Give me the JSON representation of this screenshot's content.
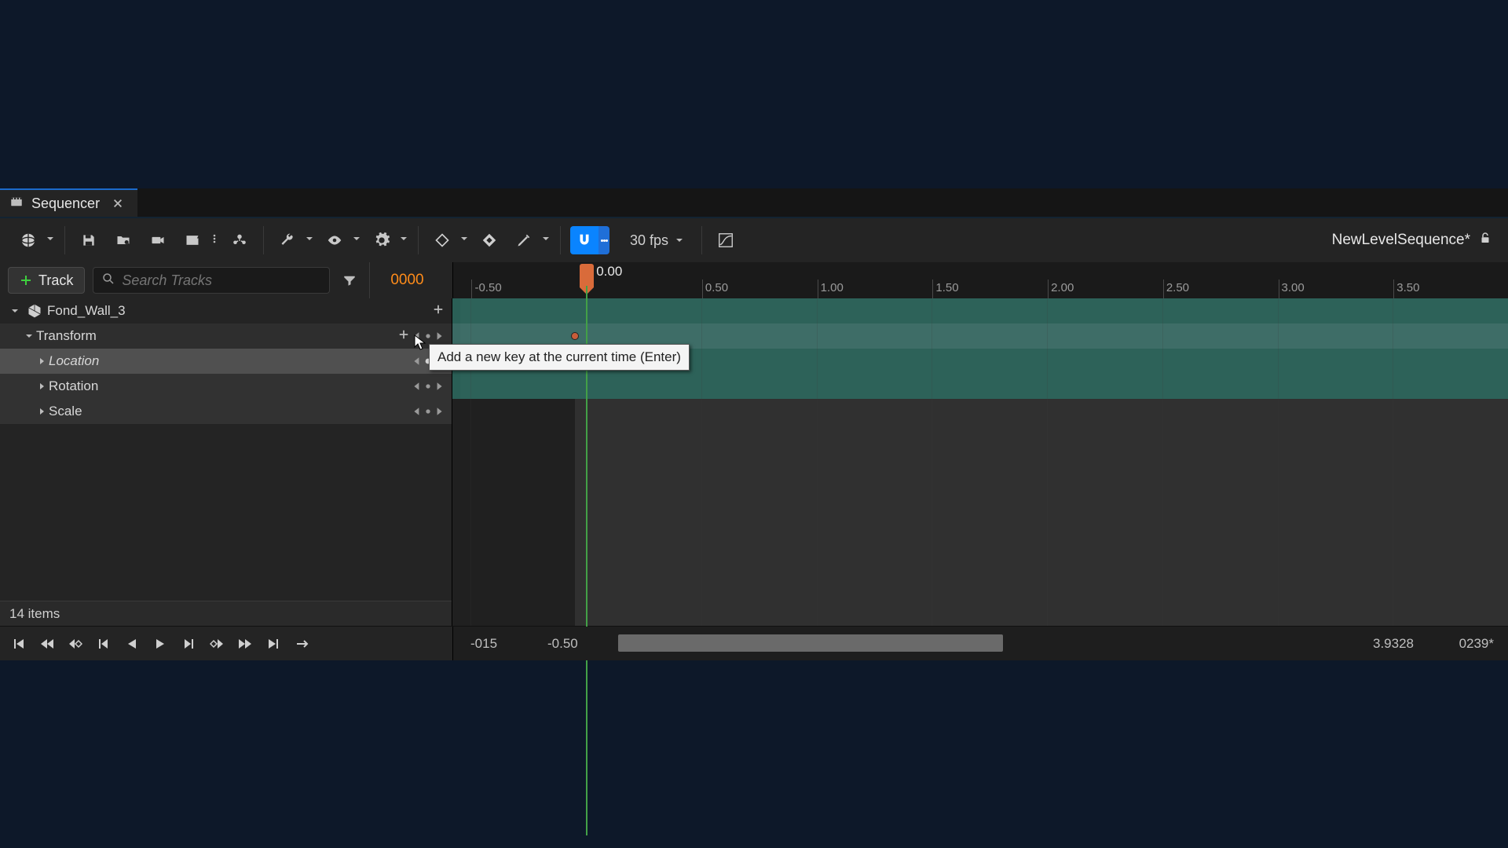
{
  "tab": {
    "title": "Sequencer"
  },
  "toolbar": {
    "fps_label": "30 fps",
    "sequence_name": "NewLevelSequence*"
  },
  "controls": {
    "track_button": "Track",
    "search_placeholder": "Search Tracks",
    "frame_display": "0000"
  },
  "ruler": {
    "playhead_label": "0.00",
    "ticks": [
      "-0.50",
      "0.50",
      "1.00",
      "1.50",
      "2.00",
      "2.50",
      "3.00",
      "3.50"
    ]
  },
  "outliner": {
    "object": "Fond_Wall_3",
    "transform": "Transform",
    "location": "Location",
    "rotation": "Rotation",
    "scale": "Scale",
    "status": "14 items"
  },
  "tooltip": "Add a new key at the current time (Enter)",
  "range": {
    "in_frame": "-015",
    "in_time": "-0.50",
    "out_time": "3.9328",
    "out_frame": "0239*"
  }
}
